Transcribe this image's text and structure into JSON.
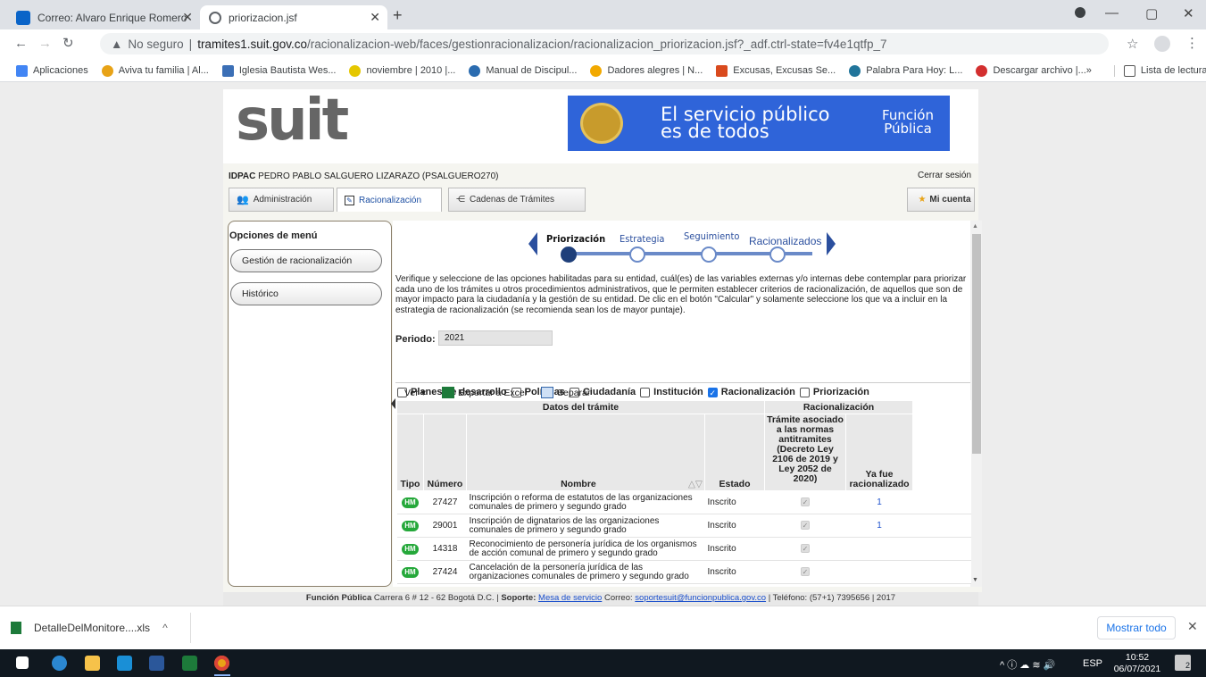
{
  "browser": {
    "tabs": [
      {
        "title": "Correo: Alvaro Enrique Romero G",
        "active": false
      },
      {
        "title": "priorizacion.jsf",
        "active": true
      }
    ],
    "address": {
      "security": "No seguro",
      "host": "tramites1.suit.gov.co",
      "path": "/racionalizacion-web/faces/gestionracionalizacion/racionalizacion_priorizacion.jsf?_adf.ctrl-state=fv4e1qtfp_7"
    },
    "bookmarks": [
      "Aplicaciones",
      "Aviva tu familia | Al...",
      "Iglesia Bautista Wes...",
      "noviembre | 2010 |...",
      "Manual de Discipul...",
      "Dadores alegres | N...",
      "Excusas, Excusas Se...",
      "Palabra Para Hoy: L...",
      "Descargar archivo |..."
    ],
    "reading_list": "Lista de lectura",
    "overflow": "»"
  },
  "header": {
    "logo": "suit",
    "slogan_line1": "El servicio público",
    "slogan_line2": "es de todos",
    "org_line1": "Función",
    "org_line2": "Pública"
  },
  "user": {
    "entity": "IDPAC",
    "name": "PEDRO PABLO SALGUERO LIZARAZO (PSALGUERO270)",
    "logout": "Cerrar sesión"
  },
  "app_tabs": {
    "admin": "Administración",
    "racionalizacion": "Racionalización",
    "cadenas": "Cadenas de Trámites",
    "mi_cuenta": "Mi cuenta"
  },
  "menu": {
    "title": "Opciones de menú",
    "items": [
      "Gestión de racionalización",
      "Histórico"
    ]
  },
  "wizard": {
    "steps": [
      "Priorización",
      "Estrategia",
      "Seguimiento",
      "Racionalizados"
    ]
  },
  "instructions": "Verifique y seleccione de las opciones habilitadas para su entidad, cuál(es) de las variables externas y/o internas debe contemplar para priorizar cada uno de los trámites u otros procedimientos administrativos, que le permiten establecer criterios de racionalización, de aquellos que son de mayor impacto para la ciudadanía y la gestión de su entidad. De clic en el botón \"Calcular\" y solamente seleccione los que va a incluir en la estrategia de racionalización (se recomienda sean los de mayor puntaje).",
  "period": {
    "label": "Periodo:",
    "value": "2021"
  },
  "filters": [
    {
      "label": "Planes de desarrollo",
      "checked": false
    },
    {
      "label": "Políticas",
      "checked": false
    },
    {
      "label": "Ciudadanía",
      "checked": false
    },
    {
      "label": "Institución",
      "checked": false
    },
    {
      "label": "Racionalización",
      "checked": true
    },
    {
      "label": "Priorización",
      "checked": false
    }
  ],
  "toolbar": {
    "view": "Ver",
    "export": "Exportar a Excel",
    "detach": "Separar"
  },
  "table": {
    "group_datos": "Datos del trámite",
    "group_racionalizacion": "Racionalización",
    "col_tipo": "Tipo",
    "col_numero": "Número",
    "col_nombre": "Nombre",
    "col_estado": "Estado",
    "col_asociado": "Trámite asociado a las normas antitramites (Decreto Ley 2106 de 2019 y Ley 2052 de 2020)",
    "col_ya_fue": "Ya fue racionalizado",
    "rows": [
      {
        "tipo": "HM",
        "numero": "27427",
        "nombre": "Inscripción o reforma de estatutos de las organizaciones comunales de primero y segundo grado",
        "estado": "Inscrito",
        "ya_fue": "1"
      },
      {
        "tipo": "HM",
        "numero": "29001",
        "nombre": "Inscripción de dignatarios de las organizaciones comunales de primero y segundo grado",
        "estado": "Inscrito",
        "ya_fue": "1"
      },
      {
        "tipo": "HM",
        "numero": "14318",
        "nombre": "Reconocimiento de personería jurídica de los organismos de acción comunal de primero y segundo grado",
        "estado": "Inscrito",
        "ya_fue": ""
      },
      {
        "tipo": "HM",
        "numero": "27424",
        "nombre": "Cancelación de la personería jurídica de las organizaciones comunales de primero y segundo grado",
        "estado": "Inscrito",
        "ya_fue": ""
      }
    ]
  },
  "footer": {
    "org": "Función Pública",
    "address": "Carrera 6 # 12 - 62 Bogotá D.C. |",
    "support_label": "Soporte:",
    "support_link": "Mesa de servicio",
    "mail_label": "Correo:",
    "mail": "soportesuit@funcionpublica.gov.co",
    "phone": "| Teléfono: (57+1) 7395656 | 2017"
  },
  "downloads": {
    "file": "DetalleDelMonitore....xls",
    "show_all": "Mostrar todo"
  },
  "taskbar": {
    "lang": "ESP",
    "time": "10:52",
    "date": "06/07/2021",
    "notif": "2"
  }
}
